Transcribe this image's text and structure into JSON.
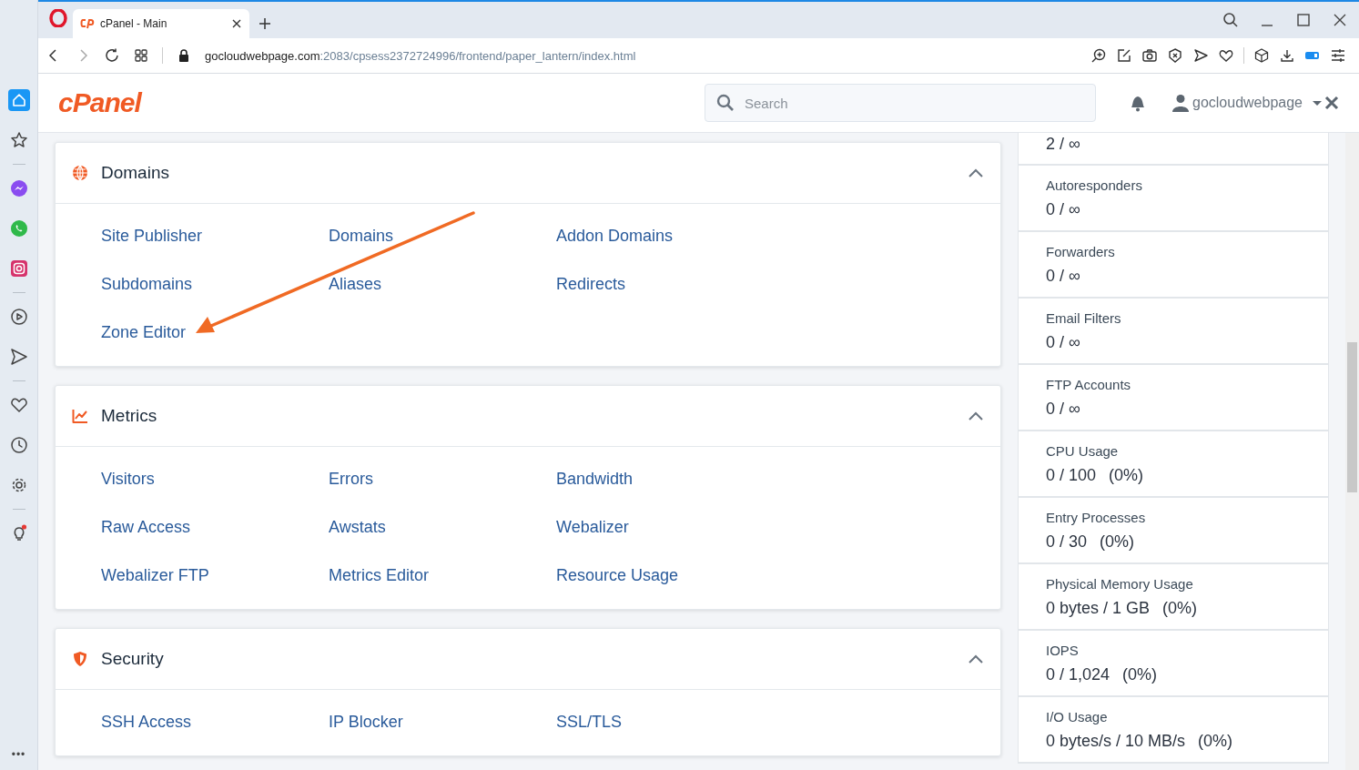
{
  "browser": {
    "tabs": [
      {
        "title": "cPanel - Main",
        "selected": true
      }
    ],
    "address": {
      "host": "gocloudwebpage.com",
      "path": ":2083/cpsess2372724996/frontend/paper_lantern/index.html"
    }
  },
  "sidebar": {
    "groups": [
      {
        "items": [
          {
            "kind": "home",
            "selected": true
          },
          {
            "kind": "star",
            "selected": false
          }
        ]
      },
      {
        "items": [
          {
            "kind": "messenger",
            "selected": false
          },
          {
            "kind": "whatsapp",
            "selected": false
          },
          {
            "kind": "instagram",
            "selected": false
          }
        ]
      },
      {
        "items": [
          {
            "kind": "player",
            "selected": false
          },
          {
            "kind": "send",
            "selected": false
          }
        ]
      },
      {
        "items": [
          {
            "kind": "heart",
            "selected": false
          },
          {
            "kind": "clock",
            "selected": false
          },
          {
            "kind": "settings",
            "selected": false
          }
        ]
      },
      {
        "items": [
          {
            "kind": "bulb",
            "selected": false
          }
        ]
      }
    ],
    "more": "•••"
  },
  "header": {
    "logo": "cPanel",
    "search": {
      "placeholder": "Search"
    },
    "user": "gocloudwebpage"
  },
  "sections": [
    {
      "title": "Domains",
      "kind": "globe",
      "expanded": true,
      "links": [
        "Site Publisher",
        "Domains",
        "Addon Domains",
        "Subdomains",
        "Aliases",
        "Redirects",
        "Zone Editor"
      ]
    },
    {
      "title": "Metrics",
      "kind": "chart",
      "expanded": true,
      "links": [
        "Visitors",
        "Errors",
        "Bandwidth",
        "Raw Access",
        "Awstats",
        "Webalizer",
        "Webalizer FTP",
        "Metrics Editor",
        "Resource Usage"
      ]
    },
    {
      "title": "Security",
      "kind": "shield",
      "expanded": true,
      "links": [
        "SSH Access",
        "IP Blocker",
        "SSL/TLS"
      ]
    }
  ],
  "stats": [
    {
      "value": "2 / ∞"
    },
    {
      "label": "Autoresponders",
      "value": "0 / ∞"
    },
    {
      "label": "Forwarders",
      "value": "0 / ∞"
    },
    {
      "label": "Email Filters",
      "value": "0 / ∞"
    },
    {
      "label": "FTP Accounts",
      "value": "0 / ∞"
    },
    {
      "label": "CPU Usage",
      "value": "0 / 100",
      "percent": "(0%)"
    },
    {
      "label": "Entry Processes",
      "value": "0 / 30",
      "percent": "(0%)"
    },
    {
      "label": "Physical Memory Usage",
      "value": "0 bytes / 1 GB",
      "percent": "(0%)"
    },
    {
      "label": "IOPS",
      "value": "0 / 1,024",
      "percent": "(0%)"
    },
    {
      "label": "I/O Usage",
      "value": "0 bytes/s / 10 MB/s",
      "percent": "(0%)"
    }
  ]
}
